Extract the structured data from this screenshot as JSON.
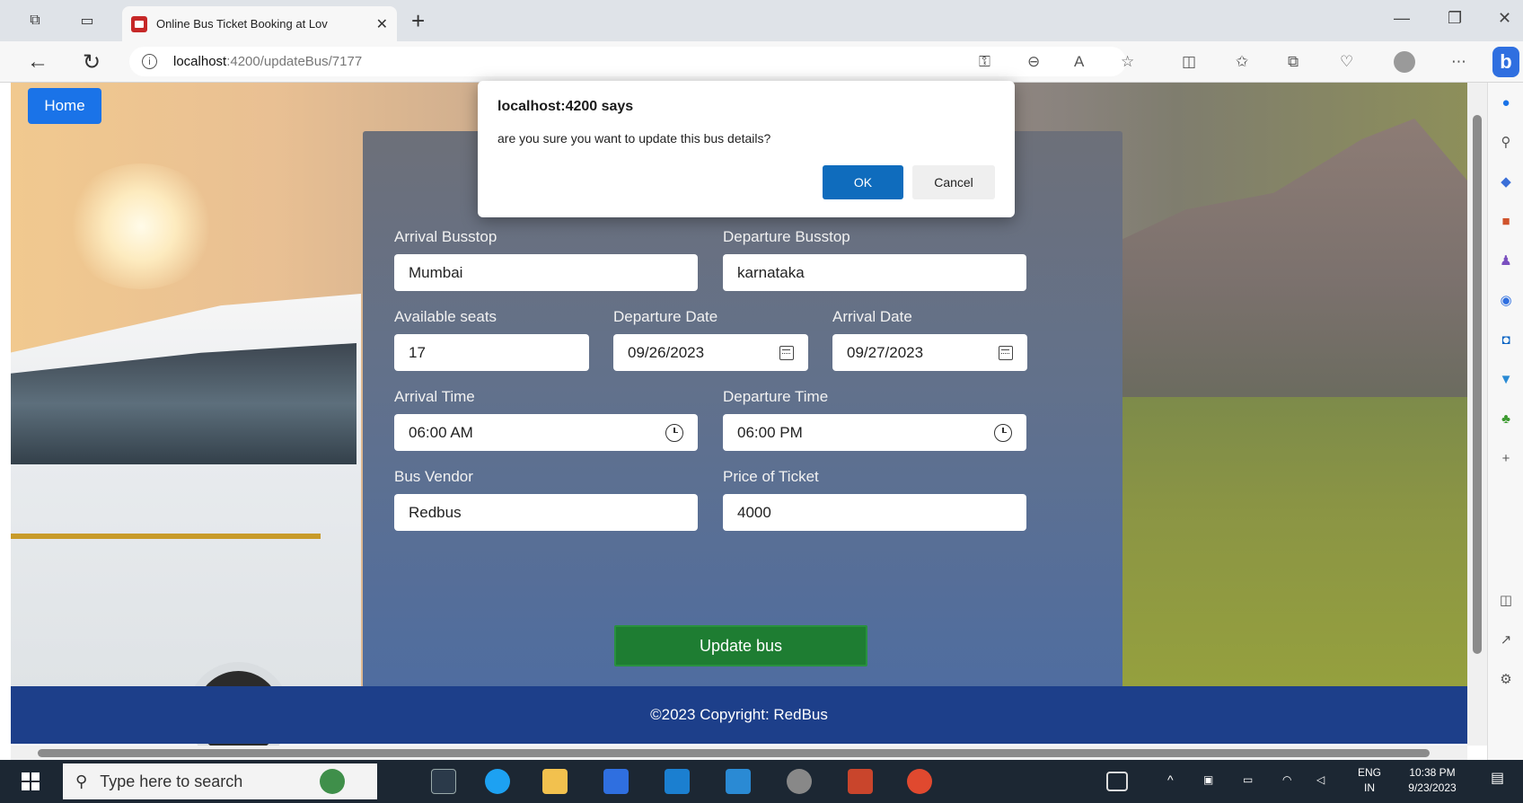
{
  "browser": {
    "tab_title": "Online Bus Ticket Booking at Lov",
    "url_host": "localhost",
    "url_path": ":4200/updateBus/7177"
  },
  "page": {
    "home_label": "Home",
    "form": {
      "arrival_busstop_label": "Arrival Busstop",
      "arrival_busstop_value": "Mumbai",
      "departure_busstop_label": "Departure Busstop",
      "departure_busstop_value": "karnataka",
      "available_seats_label": "Available seats",
      "available_seats_value": "17",
      "departure_date_label": "Departure Date",
      "departure_date_value": "09/26/2023",
      "arrival_date_label": "Arrival Date",
      "arrival_date_value": "09/27/2023",
      "arrival_time_label": "Arrival Time",
      "arrival_time_value": "06:00 AM",
      "departure_time_label": "Departure Time",
      "departure_time_value": "06:00 PM",
      "bus_vendor_label": "Bus Vendor",
      "bus_vendor_value": "Redbus",
      "price_label": "Price of Ticket",
      "price_value": "4000",
      "submit_label": "Update bus"
    },
    "footer_text": "©2023 Copyright: RedBus"
  },
  "dialog": {
    "title": "localhost:4200 says",
    "message": "are you sure you want to update this bus details?",
    "ok_label": "OK",
    "cancel_label": "Cancel"
  },
  "taskbar": {
    "search_placeholder": "Type here to search",
    "lang_line1": "ENG",
    "lang_line2": "IN",
    "time": "10:38 PM",
    "date": "9/23/2023"
  },
  "colors": {
    "primary": "#1a73e8",
    "footer": "#1d3f8a",
    "submit": "#1e7d32",
    "dialog_ok": "#0f6cbd"
  }
}
